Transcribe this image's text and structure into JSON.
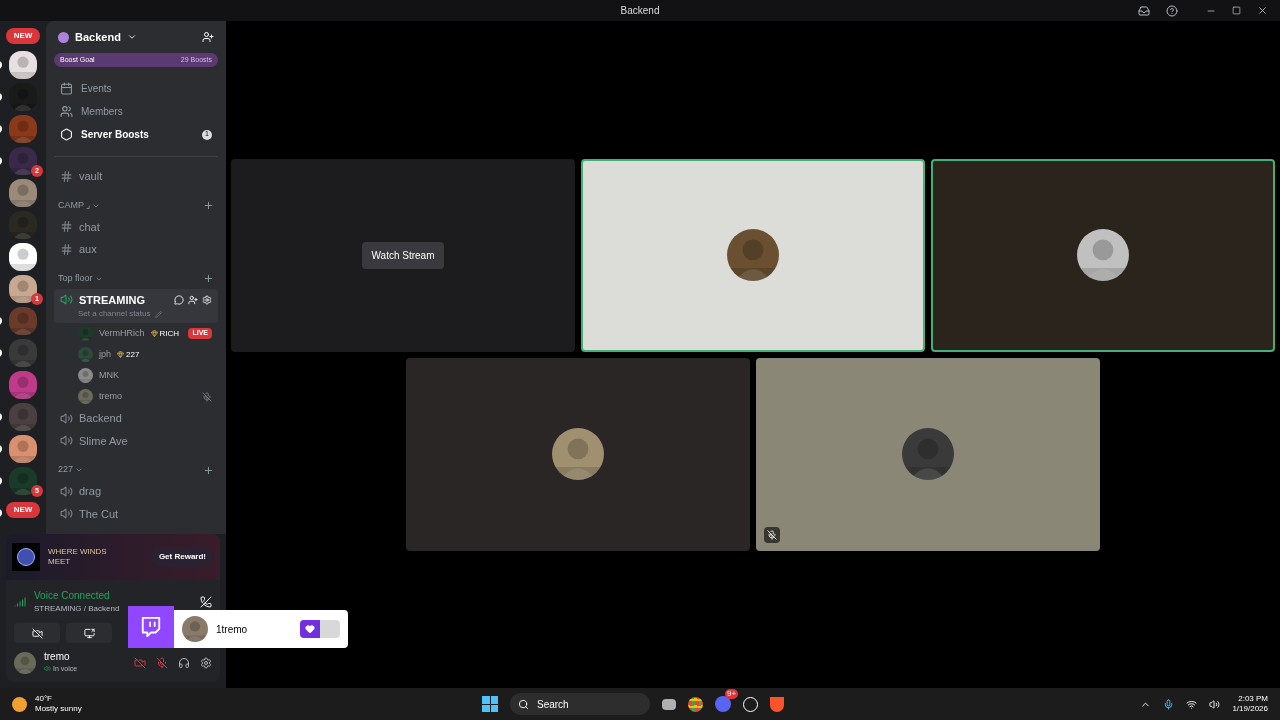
{
  "window": {
    "title": "Backend"
  },
  "servers": [
    {
      "kind": "new",
      "badge": "NEW",
      "unread": false
    },
    {
      "kind": "picture",
      "color": "#e8e0e0",
      "unread": true
    },
    {
      "kind": "picture",
      "color": "#1a1a1a",
      "unread": true
    },
    {
      "kind": "picture",
      "color": "#8a3a1a",
      "unread": true
    },
    {
      "kind": "picture",
      "color": "#3a2a4a",
      "unread": true,
      "badge": "2"
    },
    {
      "kind": "picture",
      "color": "#9a8a7a",
      "unread": false
    },
    {
      "kind": "picture",
      "color": "#2a2a22",
      "unread": false
    },
    {
      "kind": "picture",
      "color": "#ffffff",
      "unread": false
    },
    {
      "kind": "picture",
      "color": "#c8a890",
      "unread": false,
      "badge": "1"
    },
    {
      "kind": "picture",
      "color": "#6a3a2a",
      "unread": true
    },
    {
      "kind": "picture",
      "color": "#3a3a3a",
      "unread": true
    },
    {
      "kind": "picture",
      "color": "#c03a8a",
      "unread": false
    },
    {
      "kind": "picture",
      "color": "#4a4040",
      "unread": true
    },
    {
      "kind": "picture",
      "color": "#d89070",
      "unread": true
    },
    {
      "kind": "picture",
      "color": "#1a3a2a",
      "unread": true,
      "badge": "5"
    },
    {
      "kind": "new",
      "badge": "NEW",
      "unread": true
    }
  ],
  "sidebar": {
    "server_name": "Backend",
    "boost": {
      "label": "Boost Goal",
      "count": "29 Boosts"
    },
    "nav": [
      {
        "kind": "events",
        "label": "Events",
        "selected": false
      },
      {
        "kind": "members",
        "label": "Members",
        "selected": false
      },
      {
        "kind": "boosts",
        "label": "Server Boosts",
        "selected": false,
        "badge": "1"
      }
    ],
    "channels": [
      {
        "kind": "text",
        "name": "vault",
        "selected": false
      },
      {
        "kind": "category",
        "name": "CAMP ⌟",
        "children": [
          {
            "kind": "text",
            "name": "chat",
            "selected": false
          },
          {
            "kind": "text",
            "name": "aux",
            "selected": false
          }
        ]
      },
      {
        "kind": "category",
        "name": "Top floor",
        "children": [
          {
            "kind": "voice",
            "name": "STREAMING",
            "selected": true,
            "status": "Set a channel status",
            "members": [
              {
                "name": "VermHRich",
                "tag": "RICH",
                "live": "LIVE",
                "muted": false
              },
              {
                "name": "jph",
                "tag": "227",
                "muted": false
              },
              {
                "name": "MNK",
                "muted": false
              },
              {
                "name": "tremo",
                "muted": true
              }
            ]
          },
          {
            "kind": "voice",
            "name": "Backend",
            "selected": false
          },
          {
            "kind": "voice",
            "name": "Slime Ave",
            "selected": false
          }
        ]
      },
      {
        "kind": "category",
        "name": "227",
        "children": [
          {
            "kind": "voice",
            "name": "drag",
            "selected": false
          },
          {
            "kind": "voice",
            "name": "The Cut",
            "selected": false
          }
        ]
      }
    ]
  },
  "promo": {
    "logo": "WHERE WINDS MEET",
    "button": "Get Reward!"
  },
  "voice": {
    "status": "Voice Connected",
    "channel": "STREAMING / Backend"
  },
  "popup": {
    "name": "1tremo",
    "level": 0.5
  },
  "user": {
    "name": "tremo",
    "status": "In voice",
    "camera_off": true,
    "mic_muted": true,
    "deafened": false
  },
  "tiles": [
    {
      "kind": "stream",
      "button": "Watch Stream",
      "color": "#1c1c1e",
      "speaking": false,
      "muted": false
    },
    {
      "kind": "avatar",
      "color": "#dcdcd8",
      "speaking": true,
      "muted": false
    },
    {
      "kind": "avatar",
      "color": "#2a241d",
      "speaking": true,
      "muted": false
    },
    {
      "kind": "avatar",
      "color": "#2a2626",
      "speaking": false,
      "muted": false
    },
    {
      "kind": "avatar",
      "color": "#8b8777",
      "speaking": false,
      "muted": true
    }
  ],
  "taskbar": {
    "temperature": "40°F",
    "weather": "Mostly sunny",
    "search": "Search",
    "discord_badge": "9+",
    "time": "2:03 PM",
    "date": "1/19/2026"
  }
}
